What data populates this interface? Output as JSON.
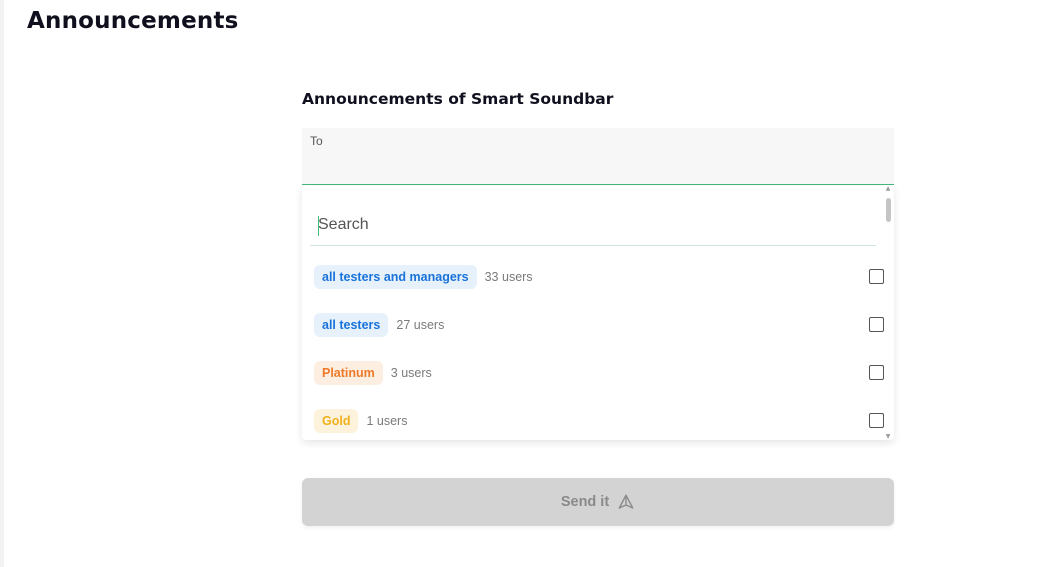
{
  "page": {
    "title": "Announcements"
  },
  "section": {
    "title": "Announcements of Smart Soundbar"
  },
  "to_field": {
    "label": "To"
  },
  "search": {
    "placeholder": "Search",
    "value": ""
  },
  "options": [
    {
      "label": "all testers and managers",
      "count": "33 users",
      "color": "#1a73d9",
      "checked": false
    },
    {
      "label": "all testers",
      "count": "27 users",
      "color": "#1a73d9",
      "checked": false
    },
    {
      "label": "Platinum",
      "count": "3 users",
      "color": "#ee7a28",
      "checked": false
    },
    {
      "label": "Gold",
      "count": "1 users",
      "color": "#f0b01c",
      "checked": false
    }
  ],
  "send": {
    "label": "Send it",
    "icon": "send-icon",
    "disabled": true
  },
  "colors": {
    "accent": "#43b97a",
    "button_disabled": "#d3d3d3"
  }
}
